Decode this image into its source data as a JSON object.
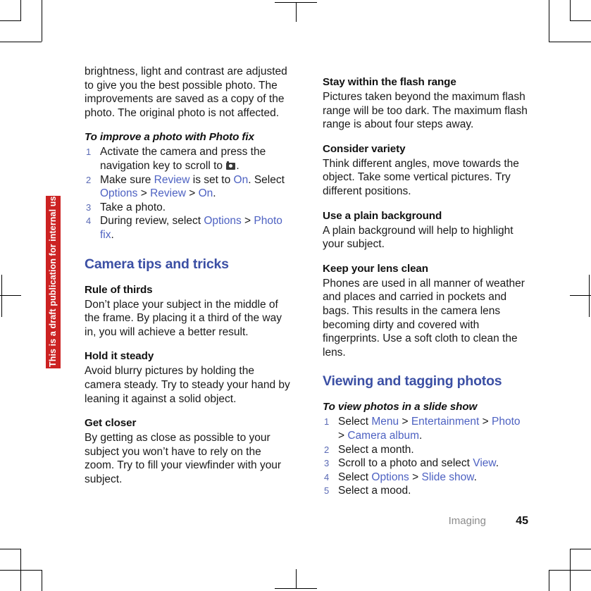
{
  "watermark": {
    "text": "This is a draft publication for internal use only.",
    "background_color": "#cc2222",
    "text_color": "#ffffff"
  },
  "colors": {
    "heading_blue": "#3b4fa4",
    "link_blue": "#4e62c2",
    "body_black": "#1a1a1a",
    "footer_gray": "#8c8c8c"
  },
  "left_column": {
    "continued_paragraph": "brightness, light and contrast are adjusted to give you the best possible photo. The improvements are saved as a copy of the photo. The original photo is not affected.",
    "task": {
      "heading": "To improve a photo with Photo fix",
      "steps": [
        {
          "parts": [
            {
              "type": "text",
              "value": "Activate the camera and press the navigation key to scroll to "
            },
            {
              "type": "icon",
              "value": "camera-icon"
            },
            {
              "type": "text",
              "value": "."
            }
          ]
        },
        {
          "parts": [
            {
              "type": "text",
              "value": "Make sure "
            },
            {
              "type": "ui",
              "value": "Review"
            },
            {
              "type": "text",
              "value": " is set to "
            },
            {
              "type": "ui",
              "value": "On"
            },
            {
              "type": "text",
              "value": ". Select "
            },
            {
              "type": "ui",
              "value": "Options"
            },
            {
              "type": "text",
              "value": " > "
            },
            {
              "type": "ui",
              "value": "Review"
            },
            {
              "type": "text",
              "value": " > "
            },
            {
              "type": "ui",
              "value": "On"
            },
            {
              "type": "text",
              "value": "."
            }
          ]
        },
        {
          "parts": [
            {
              "type": "text",
              "value": "Take a photo."
            }
          ]
        },
        {
          "parts": [
            {
              "type": "text",
              "value": "During review, select "
            },
            {
              "type": "ui",
              "value": "Options"
            },
            {
              "type": "text",
              "value": " > "
            },
            {
              "type": "ui",
              "value": "Photo fix"
            },
            {
              "type": "text",
              "value": "."
            }
          ]
        }
      ]
    },
    "section_heading": "Camera tips and tricks",
    "tips": [
      {
        "heading": "Rule of thirds",
        "body": "Don’t place your subject in the middle of the frame. By placing it a third of the way in, you will achieve a better result."
      },
      {
        "heading": "Hold it steady",
        "body": "Avoid blurry pictures by holding the camera steady. Try to steady your hand by leaning it against a solid object."
      },
      {
        "heading": "Get closer",
        "body": "By getting as close as possible to your subject you won’t have to rely on the zoom. Try to fill your viewfinder with your subject."
      }
    ]
  },
  "right_column": {
    "tips": [
      {
        "heading": "Stay within the flash range",
        "body": "Pictures taken beyond the maximum flash range will be too dark. The maximum flash range is about four steps away."
      },
      {
        "heading": "Consider variety",
        "body": "Think different angles, move towards the object. Take some vertical pictures. Try different positions."
      },
      {
        "heading": "Use a plain background",
        "body": "A plain background will help to highlight your subject."
      },
      {
        "heading": "Keep your lens clean",
        "body": "Phones are used in all manner of weather and places and carried in pockets and bags. This results in the camera lens becoming dirty and covered with fingerprints. Use a soft cloth to clean the lens."
      }
    ],
    "section_heading": "Viewing and tagging photos",
    "task": {
      "heading": "To view photos in a slide show",
      "steps": [
        {
          "parts": [
            {
              "type": "text",
              "value": "Select "
            },
            {
              "type": "ui",
              "value": "Menu"
            },
            {
              "type": "text",
              "value": " > "
            },
            {
              "type": "ui",
              "value": "Entertainment"
            },
            {
              "type": "text",
              "value": " > "
            },
            {
              "type": "ui",
              "value": "Photo"
            },
            {
              "type": "text",
              "value": " > "
            },
            {
              "type": "ui",
              "value": "Camera album"
            },
            {
              "type": "text",
              "value": "."
            }
          ]
        },
        {
          "parts": [
            {
              "type": "text",
              "value": "Select a month."
            }
          ]
        },
        {
          "parts": [
            {
              "type": "text",
              "value": "Scroll to a photo and select "
            },
            {
              "type": "ui",
              "value": "View"
            },
            {
              "type": "text",
              "value": "."
            }
          ]
        },
        {
          "parts": [
            {
              "type": "text",
              "value": "Select "
            },
            {
              "type": "ui",
              "value": "Options"
            },
            {
              "type": "text",
              "value": " > "
            },
            {
              "type": "ui",
              "value": "Slide show"
            },
            {
              "type": "text",
              "value": "."
            }
          ]
        },
        {
          "parts": [
            {
              "type": "text",
              "value": "Select a mood."
            }
          ]
        }
      ]
    }
  },
  "footer": {
    "chapter": "Imaging",
    "page_number": "45"
  }
}
